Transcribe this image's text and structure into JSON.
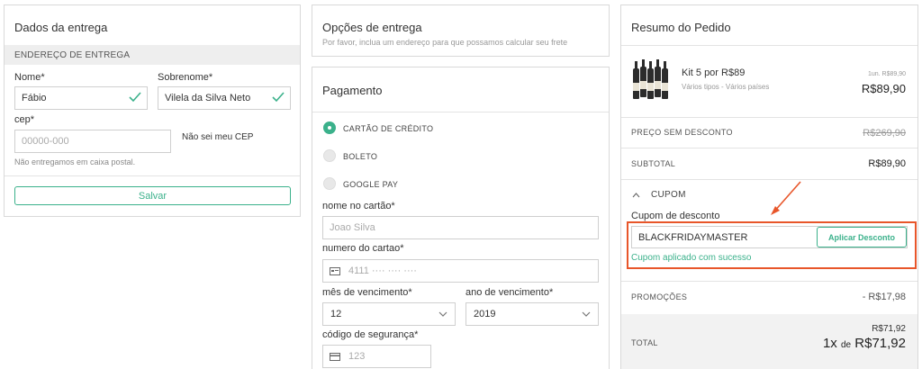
{
  "delivery": {
    "title": "Dados da entrega",
    "section": "ENDEREÇO DE ENTREGA",
    "first_name_label": "Nome*",
    "first_name_value": "Fábio",
    "last_name_label": "Sobrenome*",
    "last_name_value": "Vilela da Silva Neto",
    "cep_label": "cep*",
    "cep_placeholder": "00000-000",
    "cep_link": "Não sei meu CEP",
    "cep_help": "Não entregamos em caixa postal.",
    "save_label": "Salvar"
  },
  "options": {
    "title": "Opções de entrega",
    "subtitle": "Por favor, inclua um endereço para que possamos calcular seu frete"
  },
  "payment": {
    "title": "Pagamento",
    "methods": [
      "CARTÃO DE CRÉDITO",
      "BOLETO",
      "GOOGLE PAY"
    ],
    "card_name_label": "nome no cartão*",
    "card_name_placeholder": "Joao Silva",
    "card_number_label": "numero do cartao*",
    "card_number_placeholder": "4111 ···· ···· ····",
    "month_label": "mês de vencimento*",
    "month_value": "12",
    "year_label": "ano de vencimento*",
    "year_value": "2019",
    "cvv_label": "código de segurança*",
    "cvv_placeholder": "123"
  },
  "summary": {
    "title": "Resumo do Pedido",
    "item_name": "Kit 5 por R$89",
    "item_desc": "Vários tipos - Vários países",
    "item_unit": "1un. R$89,90",
    "item_price": "R$89,90",
    "no_discount_label": "PREÇO SEM DESCONTO",
    "no_discount_value": "R$269,90",
    "subtotal_label": "SUBTOTAL",
    "subtotal_value": "R$89,90",
    "coupon_toggle": "CUPOM",
    "coupon_label": "Cupom de desconto",
    "coupon_value": "BLACKFRIDAYMASTER",
    "coupon_button": "Aplicar Desconto",
    "coupon_success": "Cupom aplicado com sucesso",
    "promo_label": "PROMOÇÕES",
    "promo_value": "- R$17,98",
    "total_label": "TOTAL",
    "total_small": "R$71,92",
    "total_qty": "1x",
    "total_de": "de",
    "total_value": "R$71,92"
  },
  "colors": {
    "accent": "#3bb18b",
    "highlight": "#e8562a"
  }
}
